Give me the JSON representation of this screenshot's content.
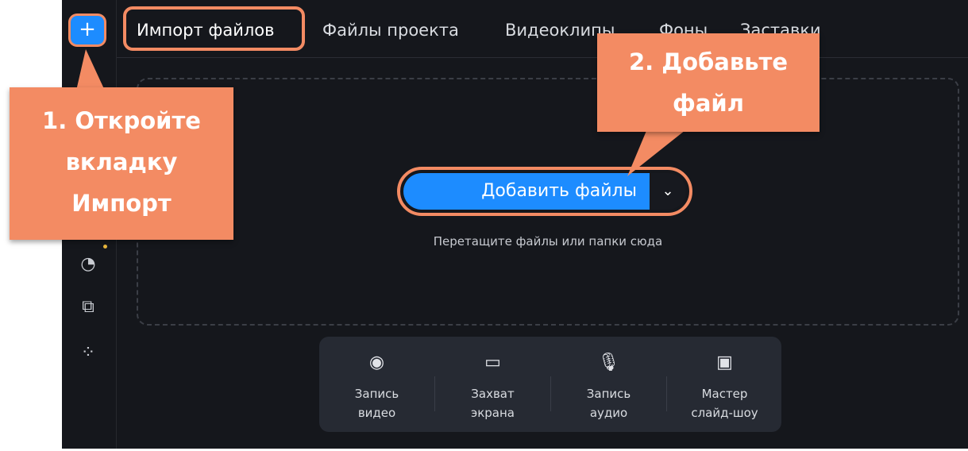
{
  "tabs": [
    {
      "label": "Импорт файлов",
      "active": true
    },
    {
      "label": "Файлы проекта",
      "active": false
    },
    {
      "label": "Видеоклипы",
      "active": false
    },
    {
      "label": "Фоны",
      "active": false
    },
    {
      "label": "Заставки",
      "active": false
    }
  ],
  "sidebar": {
    "plus_label": "+",
    "icons": [
      "music-note-icon",
      "sticker-icon",
      "transitions-icon",
      "more-apps-icon"
    ]
  },
  "dropzone": {
    "add_button_label": "Добавить файлы",
    "hint": "Перетащите файлы или папки сюда"
  },
  "tools": [
    {
      "line1": "Запись",
      "line2": "видео",
      "icon": "webcam-icon"
    },
    {
      "line1": "Захват",
      "line2": "экрана",
      "icon": "monitor-icon"
    },
    {
      "line1": "Запись",
      "line2": "аудио",
      "icon": "microphone-icon"
    },
    {
      "line1": "Мастер",
      "line2": "слайд-шоу",
      "icon": "slideshow-icon"
    }
  ],
  "callouts": {
    "step1": [
      "1. Откройте",
      "вкладку",
      "Импорт"
    ],
    "step2": [
      "2. Добавьте",
      "файл"
    ]
  },
  "colors": {
    "accent": "#1d8cff",
    "callout": "#f38b63",
    "background": "#15171c"
  }
}
